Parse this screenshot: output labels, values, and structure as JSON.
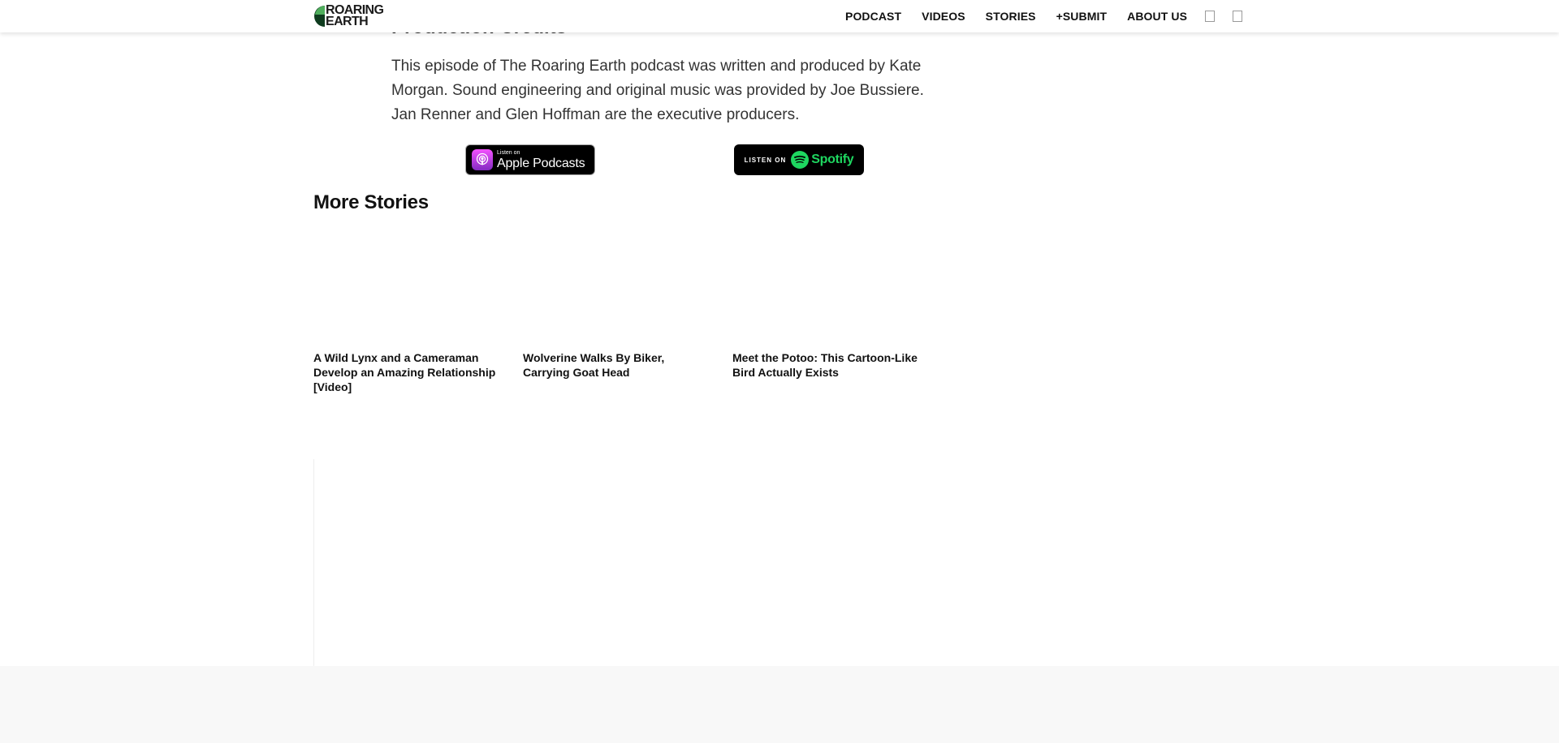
{
  "header": {
    "logo_line1": "ROARING",
    "logo_line2": "EARTH",
    "nav": [
      "PODCAST",
      "VIDEOS",
      "STORIES",
      "+SUBMIT",
      "ABOUT US"
    ],
    "icons": [
      "search-icon",
      "menu-icon"
    ]
  },
  "article": {
    "section_heading": "Production Credits",
    "credits": "This episode of The Roaring Earth podcast was written and produced by Kate Morgan.  Sound engineering and original music was provided by Joe Bussiere. Jan Renner and Glen Hoffman are the executive producers.",
    "apple_badge": {
      "small": "Listen on",
      "big": "Apple Podcasts"
    },
    "spotify_badge": {
      "small": "LISTEN ON",
      "big": "Spotify"
    }
  },
  "more_stories": {
    "title": "More Stories",
    "items": [
      {
        "title": "A Wild Lynx and a Cameraman Develop an Amazing Relationship [Video]"
      },
      {
        "title": "Wolverine Walks By Biker, Carrying Goat Head"
      },
      {
        "title": "Meet the Potoo: This Cartoon-Like Bird Actually Exists"
      }
    ]
  },
  "colors": {
    "logo_green_light": "#4fae5c",
    "logo_green_dark": "#0e3b1e",
    "spotify_green": "#1ed760",
    "podcast_purple": "#b43ee6",
    "footer_bg": "#f8f8f8"
  }
}
